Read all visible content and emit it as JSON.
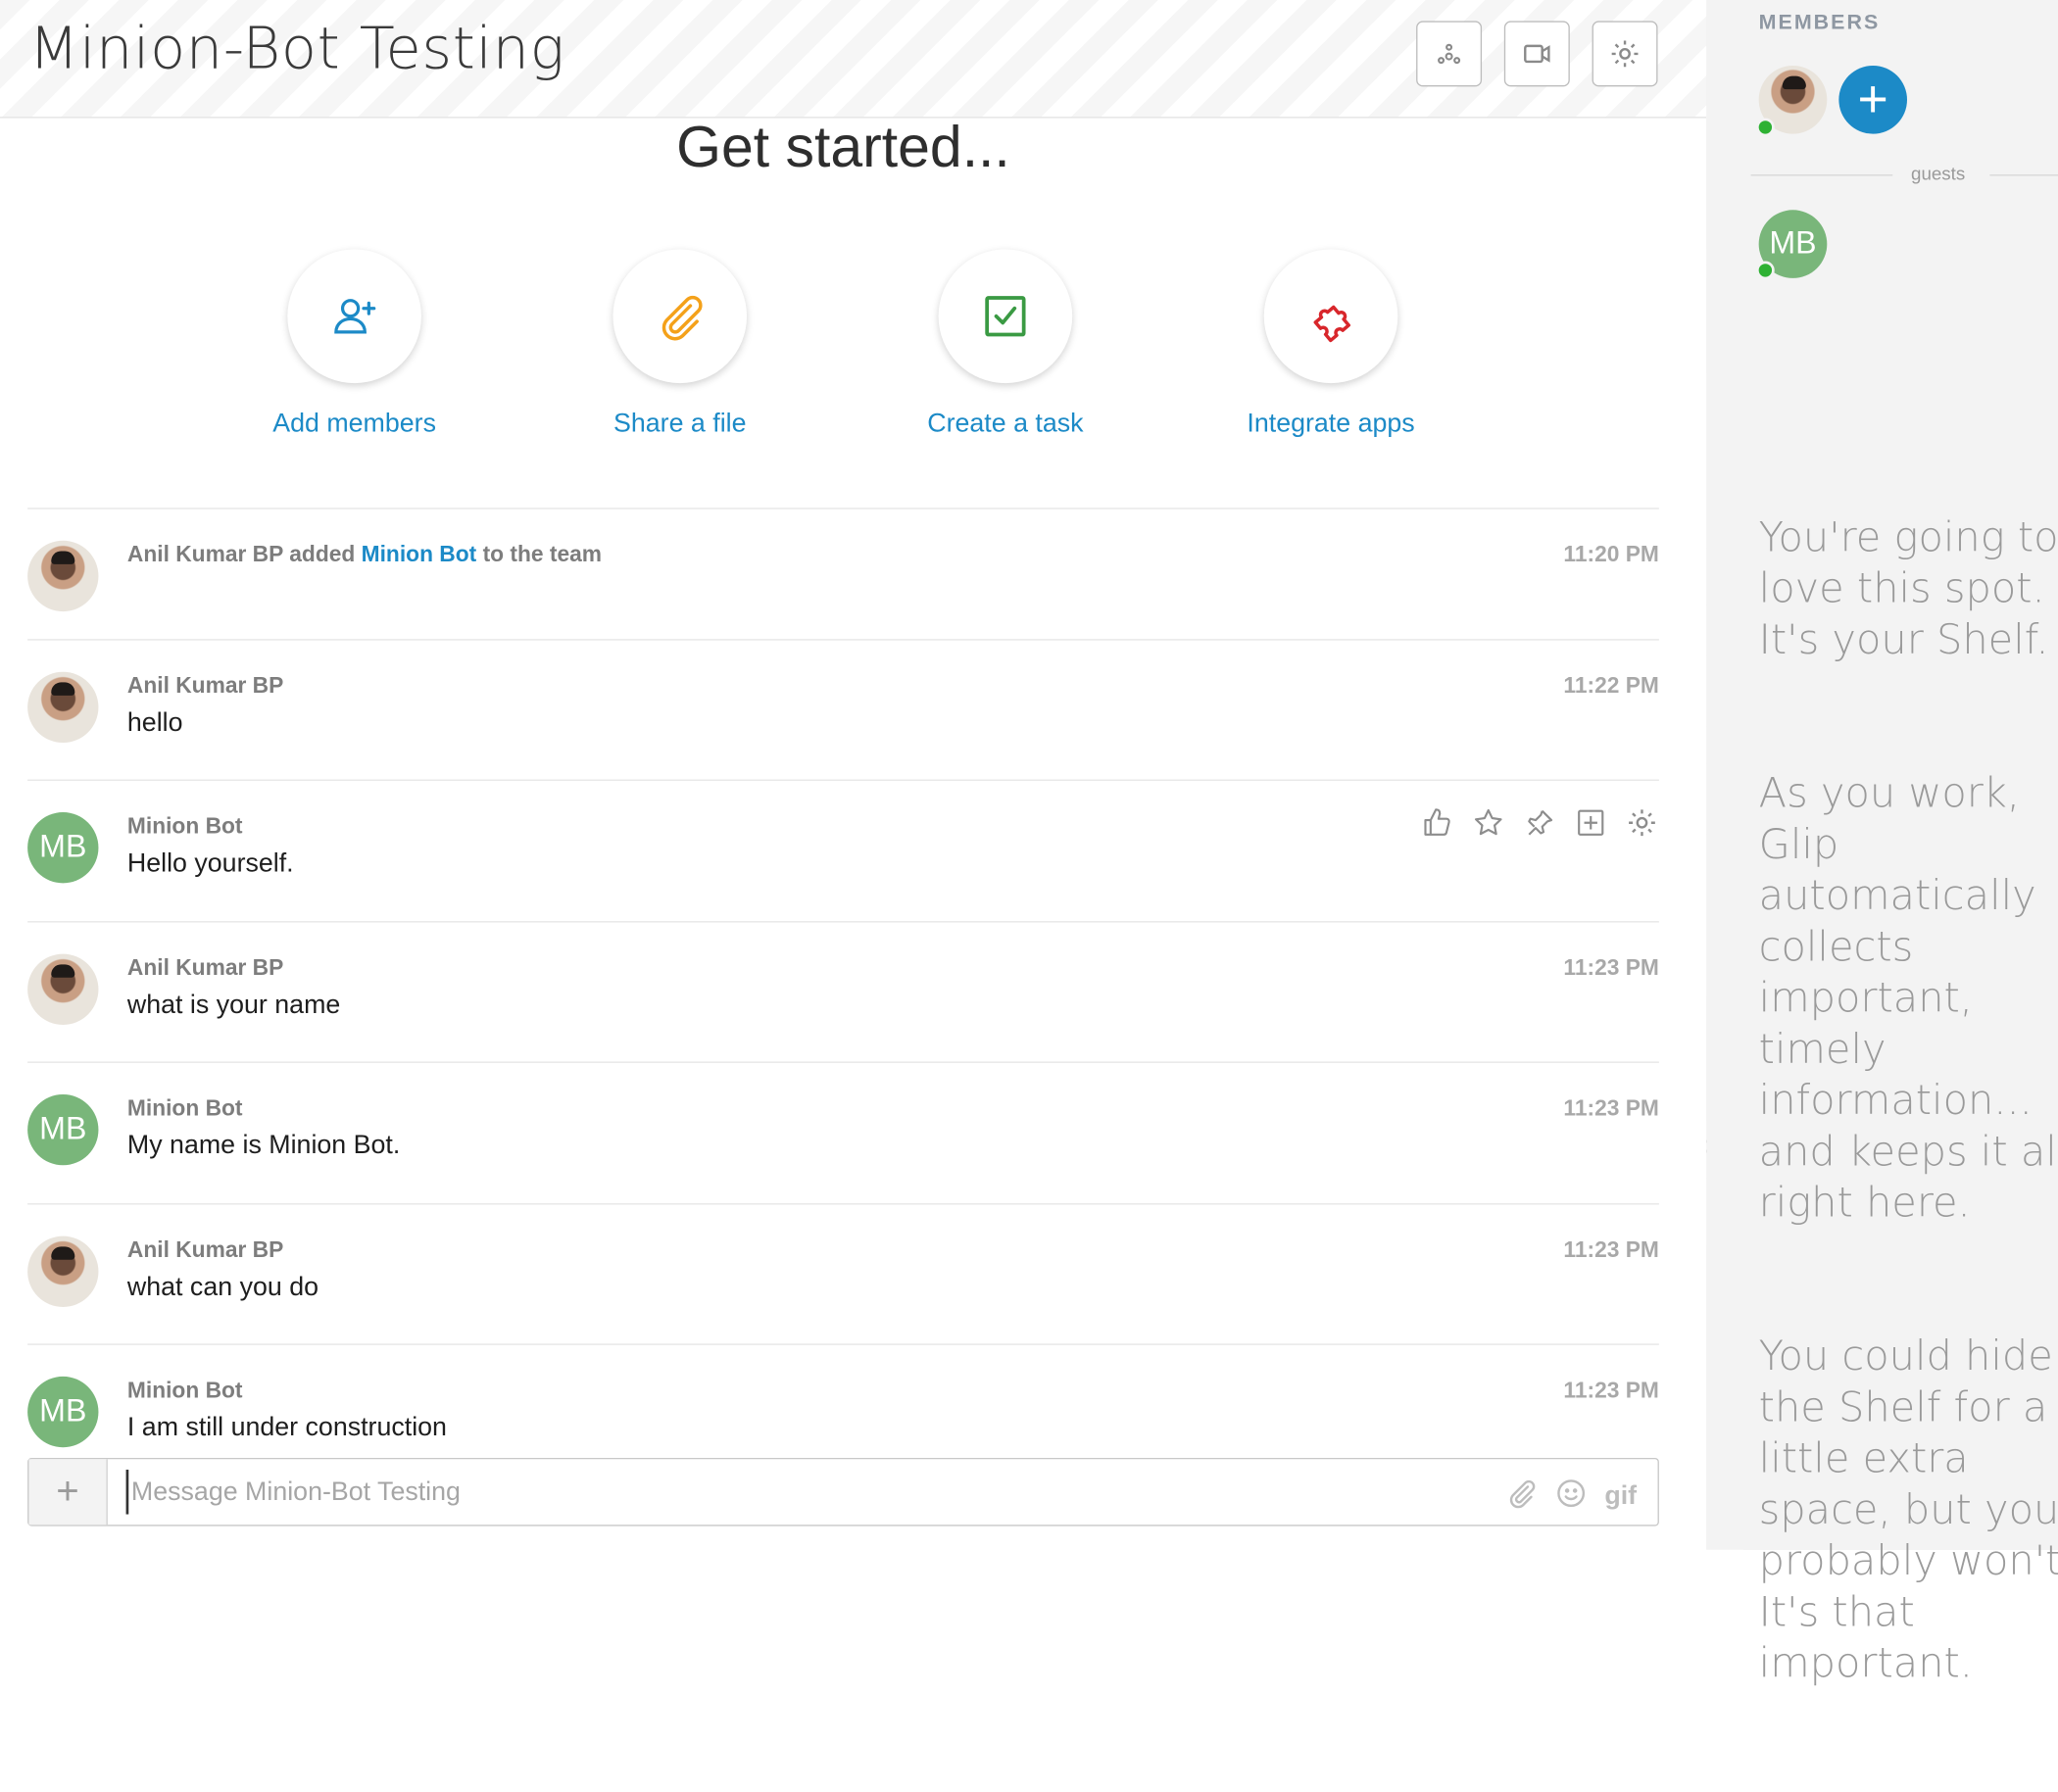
{
  "header": {
    "team_title": "Minion-Bot Testing",
    "buttons": [
      "integrations-icon",
      "video-icon",
      "settings-icon"
    ]
  },
  "get_started": {
    "title": "Get started...",
    "actions": [
      {
        "label": "Add members",
        "icon": "add-user-icon",
        "color": "#1c8ac7"
      },
      {
        "label": "Share a file",
        "icon": "paperclip-icon",
        "color": "#f4a11a"
      },
      {
        "label": "Create a task",
        "icon": "checkbox-icon",
        "color": "#3a9a43"
      },
      {
        "label": "Integrate apps",
        "icon": "puzzle-icon",
        "color": "#d8262b"
      }
    ]
  },
  "feed": {
    "system_event": {
      "actor": "Anil Kumar BP",
      "verb": "added",
      "target": "Minion Bot",
      "suffix": "to the team",
      "time": "11:20 PM"
    },
    "messages": [
      {
        "sender": "Anil Kumar BP",
        "text": "hello",
        "time": "11:22 PM",
        "avatar": "photo"
      },
      {
        "sender": "Minion Bot",
        "text": "Hello yourself.",
        "time": "",
        "avatar": "MB"
      },
      {
        "sender": "Anil Kumar BP",
        "text": "what is your name",
        "time": "11:23 PM",
        "avatar": "photo"
      },
      {
        "sender": "Minion Bot",
        "text": "My name is Minion Bot.",
        "time": "11:23 PM",
        "avatar": "MB"
      },
      {
        "sender": "Anil Kumar BP",
        "text": "what can you do",
        "time": "11:23 PM",
        "avatar": "photo"
      },
      {
        "sender": "Minion Bot",
        "text": "I am still under construction",
        "time": "11:23 PM",
        "avatar": "MB"
      }
    ],
    "hover_actions": [
      "thumbs-up-icon",
      "star-icon",
      "pin-icon",
      "add-icon",
      "gear-icon"
    ]
  },
  "composer": {
    "placeholder": "Message Minion-Bot Testing",
    "plus": "+",
    "gif_label": "gif"
  },
  "shelf": {
    "members_title": "MEMBERS",
    "guests_label": "guests",
    "guest_initials": "MB",
    "add_symbol": "+",
    "paragraphs": [
      "You're going to love this spot. It's your Shelf.",
      "As you work, Glip automatically collects important, timely information... and keeps it all right here.",
      "You could hide the Shelf for a little extra space, but you probably won't. It's that important."
    ]
  },
  "colors": {
    "accent": "#1c8ac7",
    "mb_avatar": "#79b67a",
    "online": "#2eb133"
  }
}
